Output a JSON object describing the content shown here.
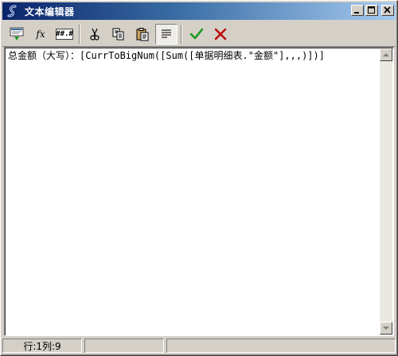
{
  "window": {
    "title": "文本编辑器"
  },
  "toolbar": {
    "buttons": [
      {
        "name": "insert-field",
        "icon": "insert-field-icon"
      },
      {
        "name": "function",
        "icon": "fx-icon",
        "label": "fx"
      },
      {
        "name": "format",
        "icon": "format-icon",
        "label": "##.#"
      },
      {
        "name": "cut",
        "icon": "scissors-icon"
      },
      {
        "name": "copy",
        "icon": "copy-icon"
      },
      {
        "name": "paste",
        "icon": "paste-icon"
      },
      {
        "name": "word-wrap",
        "icon": "wrap-lines-icon",
        "active": true
      },
      {
        "name": "ok",
        "icon": "check-icon"
      },
      {
        "name": "cancel",
        "icon": "x-icon"
      }
    ]
  },
  "editor": {
    "content": "总金额（大写）：[CurrToBigNum([Sum([单据明细表.\"金额\"],,,)])]"
  },
  "status": {
    "position": "行:1列:9",
    "panel2": "",
    "panel3": ""
  },
  "colors": {
    "title_start": "#0a246a",
    "title_end": "#a6caf0",
    "check_green": "#1f9a1f",
    "cancel_red": "#c00000"
  }
}
